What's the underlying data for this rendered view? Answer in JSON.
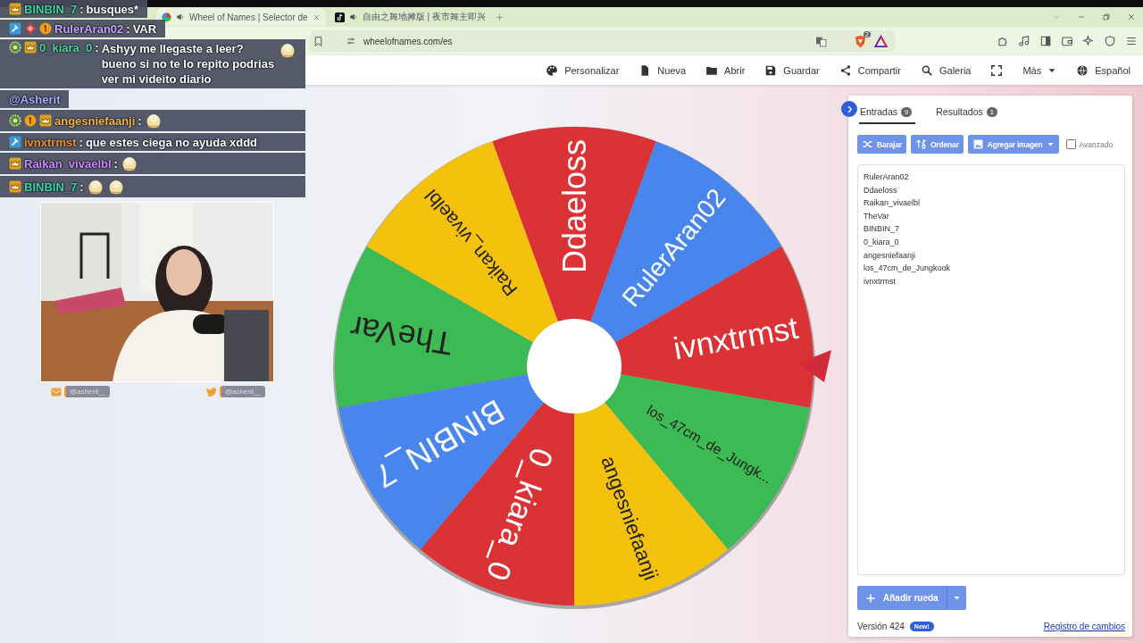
{
  "browser": {
    "tabs": [
      {
        "title": "Wheel of Names | Selector de",
        "selected": true
      },
      {
        "title": "自由之舞地摊版 | 夜市舞主即兴",
        "selected": false
      }
    ],
    "url": "wheelofnames.com/es",
    "shield_badge": "2"
  },
  "toolbar": [
    {
      "kind": "button",
      "label": "Personalizar"
    },
    {
      "kind": "button",
      "label": "Nueva"
    },
    {
      "kind": "button",
      "label": "Abrir"
    },
    {
      "kind": "button",
      "label": "Guardar"
    },
    {
      "kind": "button",
      "label": "Compartir"
    },
    {
      "kind": "button",
      "label": "Galeria"
    },
    {
      "kind": "icon"
    },
    {
      "kind": "menu",
      "label": "Más"
    },
    {
      "kind": "button",
      "label": "Español"
    }
  ],
  "wheel": {
    "segments": [
      {
        "label": "Ddaeloss",
        "color": "#db3236"
      },
      {
        "label": "RulerAran02",
        "color": "#4885ed"
      },
      {
        "label": "ivnxtrmst",
        "color": "#db3236"
      },
      {
        "label": "los_47cm_de_Jungk...",
        "color": "#3cba54"
      },
      {
        "label": "angesniefaanji",
        "color": "#f4c20d"
      },
      {
        "label": "0_kiara_0",
        "color": "#db3236"
      },
      {
        "label": "BINBIN_7",
        "color": "#4885ed"
      },
      {
        "label": "TheVar",
        "color": "#3cba54"
      },
      {
        "label": "Raikan_vivaelbl",
        "color": "#f4c20d"
      }
    ]
  },
  "panel": {
    "tabs": [
      {
        "label": "Entradas",
        "count": "9",
        "selected": true
      },
      {
        "label": "Resultados",
        "count": "1",
        "selected": false
      }
    ],
    "actions": [
      {
        "label": "Barajar",
        "dropdown": false
      },
      {
        "label": "Ordenar",
        "dropdown": false
      },
      {
        "label": "Agregar imagen",
        "dropdown": true
      }
    ],
    "advanced": {
      "label": "Avanzado",
      "checked": false
    },
    "entries": [
      "RulerAran02",
      "Ddaeloss",
      "Raikan_vivaelbl",
      "TheVar",
      "BINBIN_7",
      "0_kiara_0",
      "angesniefaanji",
      "los_47cm_de_Jungkook",
      "ivnxtrmst"
    ],
    "add_wheel": "Añadir rueda",
    "version": "Versión 424",
    "version_badge": "New!",
    "changelog": "Registro de cambios"
  },
  "chat": [
    {
      "badges": [
        {
          "kind": "crown"
        }
      ],
      "author": "BINBIN_7",
      "color": "#3ed6a8",
      "separator": ":",
      "message": "busques*"
    },
    {
      "badges": [
        {
          "kind": "hammer"
        },
        {
          "kind": "gem"
        },
        {
          "kind": "coin"
        }
      ],
      "author": "RulerAran02",
      "color": "#c4a6ff",
      "separator": ":",
      "message": "VAR"
    },
    {
      "badges": [
        {
          "kind": "flower"
        },
        {
          "kind": "crown"
        }
      ],
      "author": "0_kiara_0",
      "color": "#4fd4a4",
      "separator": ":",
      "message": "Ashyy me llegaste a leer? bueno si no te lo repito podrias ver mi videito diario",
      "emotes": [
        {
          "kind": "picture"
        }
      ]
    },
    {
      "mention": "@Asherit"
    },
    {
      "badges": [
        {
          "kind": "flower"
        },
        {
          "kind": "coin"
        },
        {
          "kind": "crown"
        }
      ],
      "author": "angesniefaanji",
      "color": "#f0b848",
      "separator": ":",
      "emotes": [
        {
          "kind": "picture"
        }
      ]
    },
    {
      "badges": [
        {
          "kind": "hammer"
        }
      ],
      "author": "ivnxtrmst",
      "color": "#e8962e",
      "separator": ":",
      "message": "que estes ciega no ayuda xddd"
    },
    {
      "badges": [
        {
          "kind": "crown"
        }
      ],
      "author": "Raikan_vivaelbl",
      "color": "#cc88ff",
      "separator": ":",
      "emotes": [
        {
          "kind": "picture"
        }
      ]
    },
    {
      "badges": [
        {
          "kind": "crown"
        }
      ],
      "author": "BINBIN_7",
      "color": "#3ed6a8",
      "separator": ":",
      "emotes": [
        {
          "kind": "picture"
        },
        {
          "kind": "picture"
        }
      ]
    }
  ],
  "webcam": {
    "kind": "picture",
    "handles": [
      "@asherit__",
      "@asherit__"
    ]
  }
}
